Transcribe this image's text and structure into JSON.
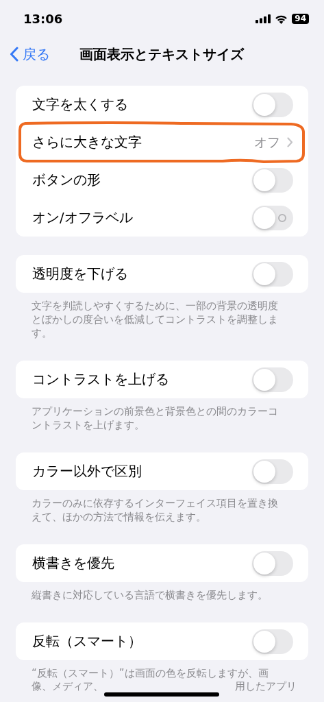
{
  "status_bar": {
    "time": "13:06",
    "battery": "94"
  },
  "nav": {
    "back": "戻る",
    "title": "画面表示とテキストサイズ"
  },
  "groups": [
    {
      "rows": [
        {
          "kind": "toggle",
          "label": "文字を太くする",
          "on": false,
          "show_label": false,
          "highlighted": false
        },
        {
          "kind": "link",
          "label": "さらに大きな文字",
          "value": "オフ",
          "highlighted": true
        },
        {
          "kind": "toggle",
          "label": "ボタンの形",
          "on": false,
          "show_label": false,
          "highlighted": false
        },
        {
          "kind": "toggle",
          "label": "オン/オフラベル",
          "on": false,
          "show_label": true,
          "highlighted": false
        }
      ]
    },
    {
      "rows": [
        {
          "kind": "toggle",
          "label": "透明度を下げる",
          "on": false,
          "show_label": false,
          "highlighted": false
        }
      ],
      "footer": "文字を判読しやすくするために、一部の背景の透明度とぼかしの度合いを低減してコントラストを調整します。"
    },
    {
      "rows": [
        {
          "kind": "toggle",
          "label": "コントラストを上げる",
          "on": false,
          "show_label": false,
          "highlighted": false
        }
      ],
      "footer": "アプリケーションの前景色と背景色との間のカラーコントラストを上げます。"
    },
    {
      "rows": [
        {
          "kind": "toggle",
          "label": "カラー以外で区別",
          "on": false,
          "show_label": false,
          "highlighted": false
        }
      ],
      "footer": "カラーのみに依存するインターフェイス項目を置き換えて、ほかの方法で情報を伝えます。"
    },
    {
      "rows": [
        {
          "kind": "toggle",
          "label": "横書きを優先",
          "on": false,
          "show_label": false,
          "highlighted": false
        }
      ],
      "footer": "縦書きに対応している言語で横書きを優先します。"
    },
    {
      "rows": [
        {
          "kind": "toggle",
          "label": "反転（スマート）",
          "on": false,
          "show_label": false,
          "highlighted": false
        }
      ],
      "footer": "“反転（スマート）”は画面の色を反転しますが、画",
      "footer_parts": [
        "像、メディア、",
        "用したアプリ"
      ]
    }
  ]
}
